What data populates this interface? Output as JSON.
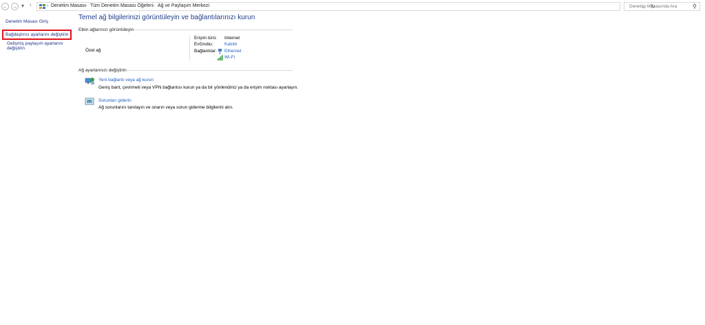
{
  "nav": {
    "back_glyph": "←",
    "forward_glyph": "→",
    "dropdown_glyph": "▾",
    "up_glyph": "↑",
    "crumb_sep": "›",
    "breadcrumbs": [
      "Denetim Masası",
      "Tüm Denetim Masası Öğeleri",
      "Ağ ve Paylaşım Merkezi"
    ],
    "address_dropdown_glyph": "⌄",
    "refresh_glyph": "↻",
    "search_placeholder": "Denetim Masasında Ara",
    "search_glyph": "⚲"
  },
  "sidebar": {
    "home": "Denetim Masası Giriş",
    "change_adapter": "Bağdaştırıcı ayarlarını değiştirin",
    "advanced_sharing_line1": "Gelişmiş paylaşım ayarlarını",
    "advanced_sharing_line2": "değiştirin"
  },
  "main": {
    "title": "Temel ağ bilgilerinizi görüntüleyin ve bağlantılarınızı kurun",
    "active_networks_heading": "Etkin ağlarınızı görüntüleyin",
    "network_name": "Özel ağ",
    "access_type_label": "Erişim türü:",
    "access_type_value": "Internet",
    "homegroup_label": "EvGrubu:",
    "homegroup_value": "Katıldı",
    "connections_label": "Bağlantılar:",
    "connections": [
      "Ethernet",
      "Wi-Fi"
    ],
    "change_settings_heading": "Ağ ayarlarınızı değiştirin",
    "new_connection_title": "Yeni bağlantı veya ağ kurun",
    "new_connection_desc": "Geniş bant, çevirmeli veya VPN bağlantısı kurun ya da bir yönlendirici ya da erişim noktası ayarlayın.",
    "troubleshoot_title": "Sorunları giderin",
    "troubleshoot_desc": "Ağ sorunlarını tanılayın ve onarın veya sorun giderme bilgilerini alın."
  },
  "colors": {
    "link": "#1f5fbd",
    "title": "#1e3c8c",
    "highlight": "#e0101a"
  }
}
